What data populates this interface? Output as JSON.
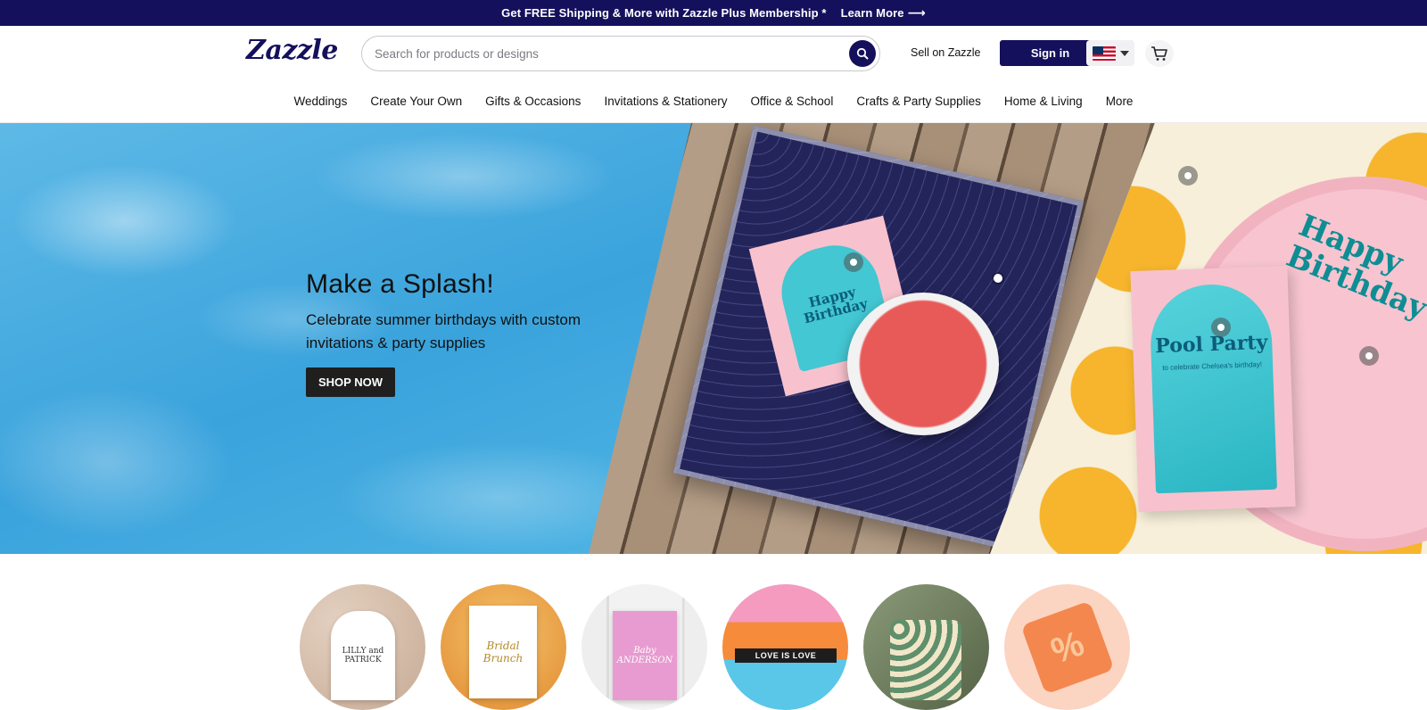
{
  "promo": {
    "text": "Get FREE Shipping & More with Zazzle Plus Membership *",
    "link_label": "Learn More",
    "link_arrow": "⟶"
  },
  "header": {
    "logo": "Zazzle",
    "search_placeholder": "Search for products or designs",
    "search_value": "",
    "sell_label": "Sell on Zazzle",
    "signin_label": "Sign in",
    "locale_icon": "us-flag-icon",
    "cart_icon": "cart-icon"
  },
  "nav": {
    "items": [
      "Weddings",
      "Create Your Own",
      "Gifts & Occasions",
      "Invitations & Stationery",
      "Office & School",
      "Crafts & Party Supplies",
      "Home & Living",
      "More"
    ]
  },
  "hero": {
    "title": "Make a Splash!",
    "subtitle": "Celebrate summer birthdays with custom invitations & party supplies",
    "cta_label": "SHOP NOW",
    "napkin_text": "Happy Birthday",
    "plate_text": "Happy Birthday",
    "invite_title": "Pool Party",
    "invite_line": "to celebrate Chelsea's birthday!"
  },
  "categories": {
    "c1_card": "LILLY and PATRICK",
    "c2_card": "Bridal Brunch",
    "c3_card": "Baby ANDERSON",
    "c4_banner": "LOVE IS LOVE",
    "c6_symbol": "%"
  },
  "colors": {
    "brand": "#15105c",
    "cta": "#1f1f1f"
  }
}
